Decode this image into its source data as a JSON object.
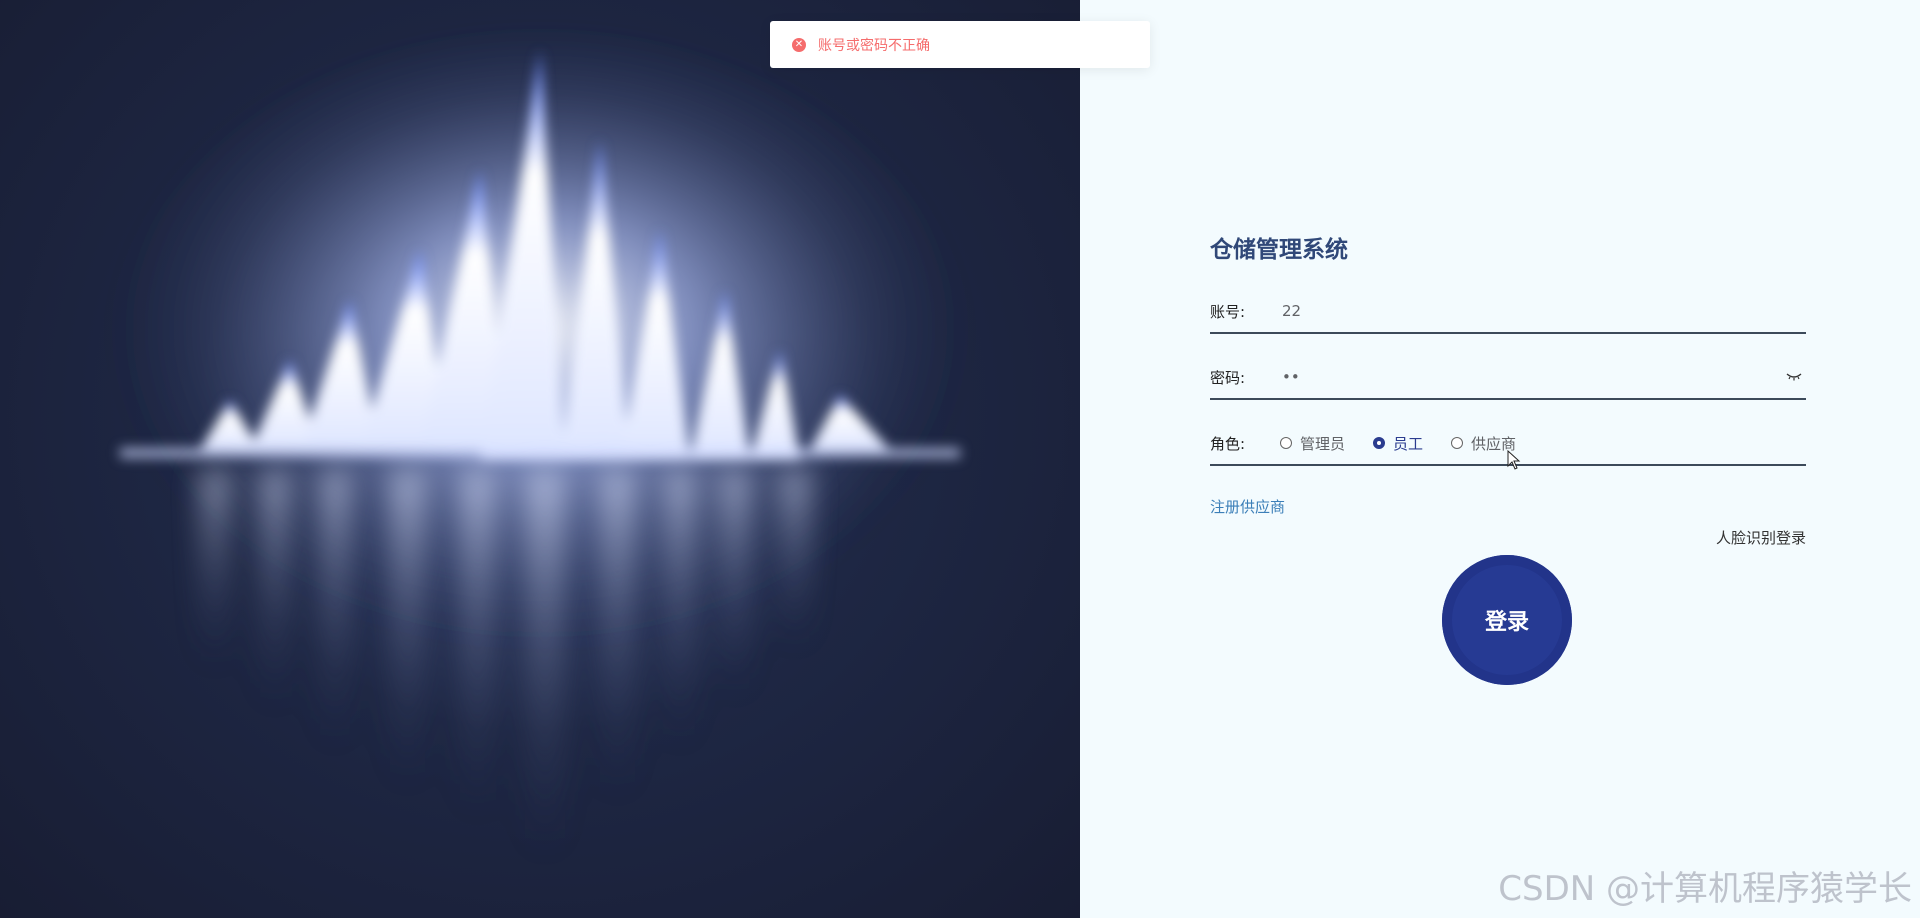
{
  "toast": {
    "icon": "error-circle-icon",
    "message": "账号或密码不正确",
    "color": "#f56c6c"
  },
  "form": {
    "title": "仓储管理系统",
    "account": {
      "label": "账号:",
      "value": "22"
    },
    "password": {
      "label": "密码:",
      "value": "••",
      "toggle_icon": "eye-closed-icon"
    },
    "role": {
      "label": "角色:",
      "options": [
        {
          "label": "管理员",
          "checked": false
        },
        {
          "label": "员工",
          "checked": true
        },
        {
          "label": "供应商",
          "checked": false
        }
      ]
    },
    "register_link": "注册供应商",
    "face_login_link": "人脸识别登录",
    "login_button": "登录"
  },
  "watermark": "CSDN @计算机程序猿学长",
  "colors": {
    "accent": "#263a93",
    "title": "#304878",
    "link": "#3b7fb8",
    "background": "#f3fbfe"
  }
}
